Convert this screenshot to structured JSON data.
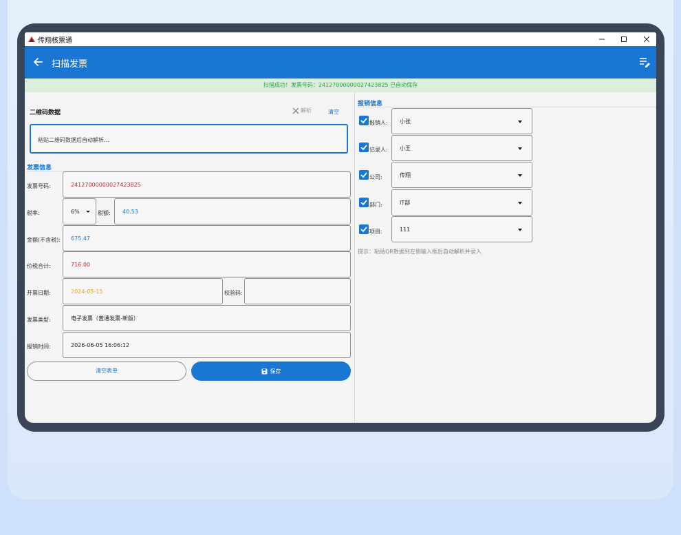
{
  "window": {
    "title": "传翔核票通",
    "minimize": "−",
    "maximize": "□",
    "close": "✕"
  },
  "appbar": {
    "title": "扫描发票"
  },
  "status": {
    "text": "扫描成功！发票号码：24127000000027423825 已自动保存"
  },
  "qr": {
    "title": "二维码数据",
    "parse_label": "解析",
    "clear_label": "清空",
    "placeholder": "粘贴二维码数据后自动解析..."
  },
  "invoice": {
    "section_title": "发票信息",
    "number_label": "发票号码:",
    "number_value": "24127000000027423825",
    "tax_rate_label": "税率:",
    "tax_rate_value": "6%",
    "tax_amount_label": "税额:",
    "tax_amount_value": "40.53",
    "amount_label": "金额(不含税):",
    "amount_value": "675.47",
    "total_label": "价税合计:",
    "total_value": "716.00",
    "date_label": "开票日期:",
    "date_value": "2024-05-15",
    "check_code_label": "校验码:",
    "check_code_value": "",
    "type_label": "发票类型:",
    "type_value": "电子发票（普通发票-新版）",
    "reimb_time_label": "报销时间:",
    "reimb_time_value": "2026-06-05 16:06:12"
  },
  "buttons": {
    "clear_form": "清空表单",
    "save": "保存"
  },
  "reimbursement": {
    "section_title": "报销信息",
    "fields": [
      {
        "label": "报销人:",
        "value": "小张"
      },
      {
        "label": "记录人:",
        "value": "小王"
      },
      {
        "label": "公司:",
        "value": "传翔"
      },
      {
        "label": "部门:",
        "value": "IT部"
      },
      {
        "label": "项目:",
        "value": "111"
      }
    ],
    "hint": "提示：粘贴QR数据到左侧输入框后自动解析并录入"
  },
  "colors": {
    "primary": "#1976d2",
    "number_red": "#c62828",
    "date_orange": "#e8a317",
    "success_green": "#2e9d47",
    "status_bg": "#dceedd",
    "frame": "#3a4658"
  }
}
